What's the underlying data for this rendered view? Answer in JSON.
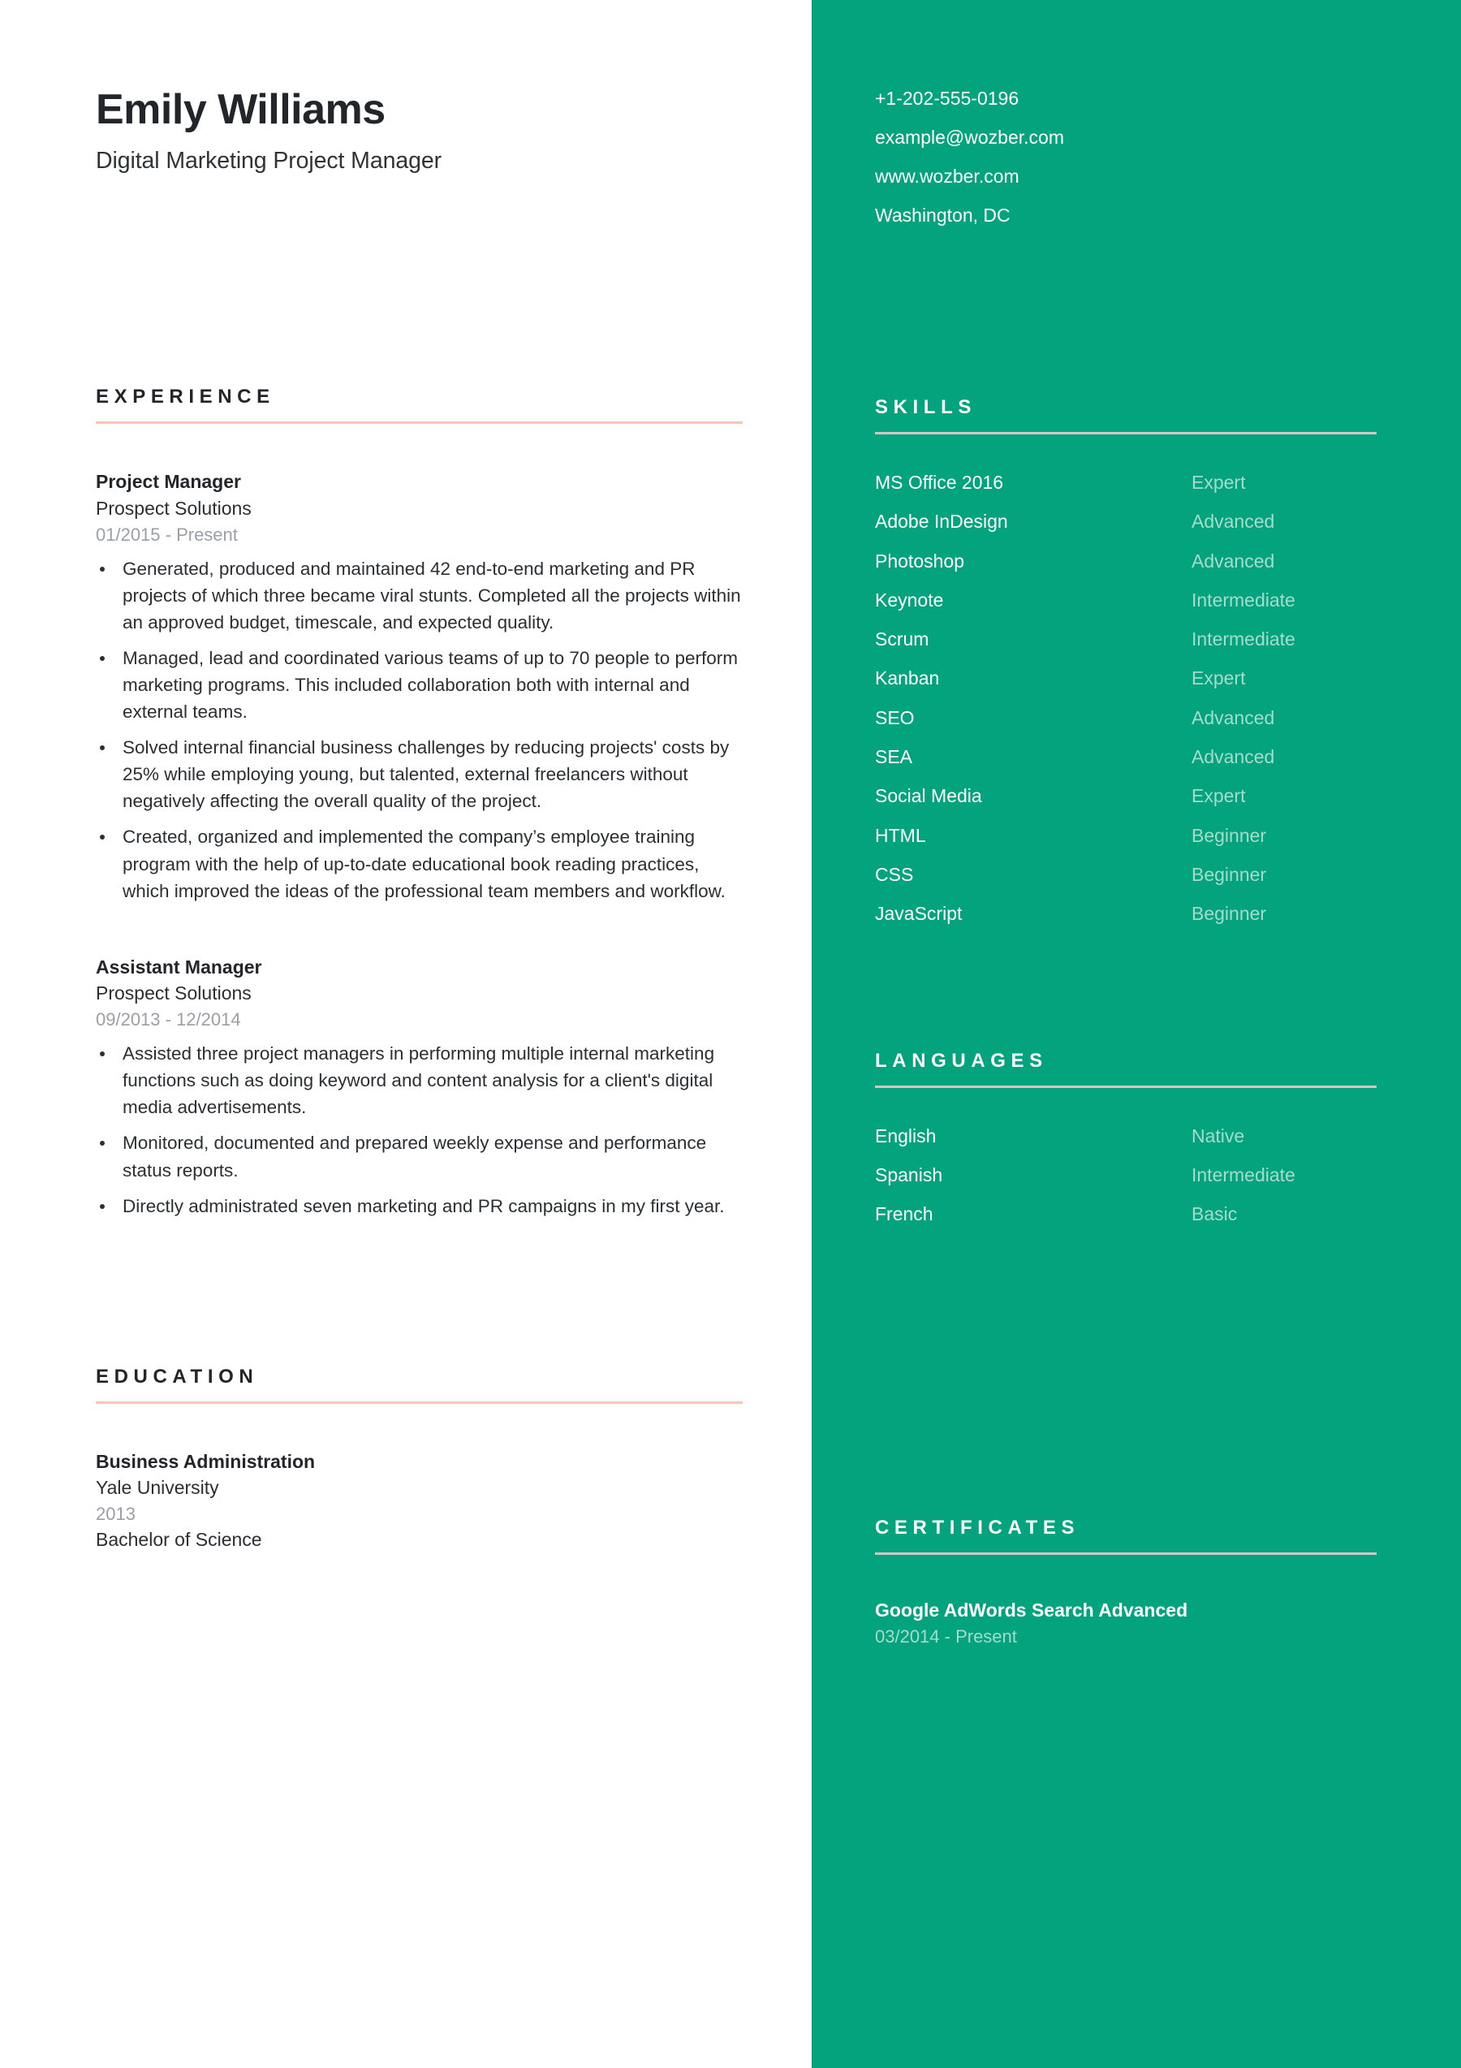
{
  "colors": {
    "accent_green": "#03a37e",
    "rule_left": "#fac6ba",
    "rule_right": "#d8c6c2",
    "muted_green_text": "#a6dccb",
    "muted_gray_text": "#9aa0a6",
    "ink": "#22262a"
  },
  "header": {
    "name": "Emily Williams",
    "headline": "Digital Marketing Project Manager"
  },
  "contact": {
    "phone": "+1-202-555-0196",
    "email": "example@wozber.com",
    "website": "www.wozber.com",
    "location": "Washington, DC"
  },
  "experience": {
    "heading": "EXPERIENCE",
    "entries": [
      {
        "title": "Project Manager",
        "organization": "Prospect Solutions",
        "date": "01/2015 - Present",
        "bullets": [
          "Generated, produced and maintained 42 end-to-end marketing and PR projects of which three became viral stunts. Completed all the projects within an approved budget, timescale, and expected quality.",
          "Managed, lead and coordinated various teams of up to 70 people to perform marketing programs. This included collaboration both with internal and external teams.",
          "Solved internal financial business challenges by reducing projects' costs by 25% while employing young, but talented, external freelancers without negatively affecting the overall quality of the project.",
          "Created, organized and implemented the company’s employee training program with the help of up-to-date educational book reading practices, which improved the ideas of the professional team members and workflow."
        ]
      },
      {
        "title": "Assistant Manager",
        "organization": "Prospect Solutions",
        "date": "09/2013 - 12/2014",
        "bullets": [
          "Assisted three project managers in performing multiple internal marketing functions such as doing keyword and content analysis for a client's digital media advertisements.",
          "Monitored, documented and prepared weekly expense and performance status reports.",
          "Directly administrated seven marketing and PR campaigns in my first year."
        ]
      }
    ]
  },
  "education": {
    "heading": "EDUCATION",
    "entries": [
      {
        "title": "Business Administration",
        "organization": "Yale University",
        "date": "2013",
        "degree": "Bachelor of Science"
      }
    ]
  },
  "skills": {
    "heading": "SKILLS",
    "items": [
      {
        "name": "MS Office 2016",
        "level": "Expert"
      },
      {
        "name": "Adobe InDesign",
        "level": "Advanced"
      },
      {
        "name": "Photoshop",
        "level": "Advanced"
      },
      {
        "name": "Keynote",
        "level": "Intermediate"
      },
      {
        "name": "Scrum",
        "level": "Intermediate"
      },
      {
        "name": "Kanban",
        "level": "Expert"
      },
      {
        "name": "SEO",
        "level": "Advanced"
      },
      {
        "name": "SEA",
        "level": "Advanced"
      },
      {
        "name": "Social Media",
        "level": "Expert"
      },
      {
        "name": "HTML",
        "level": "Beginner"
      },
      {
        "name": "CSS",
        "level": "Beginner"
      },
      {
        "name": "JavaScript",
        "level": "Beginner"
      }
    ]
  },
  "languages": {
    "heading": "LANGUAGES",
    "items": [
      {
        "name": "English",
        "level": "Native"
      },
      {
        "name": "Spanish",
        "level": "Intermediate"
      },
      {
        "name": "French",
        "level": "Basic"
      }
    ]
  },
  "certificates": {
    "heading": "CERTIFICATES",
    "items": [
      {
        "name": "Google AdWords Search Advanced",
        "date": "03/2014 - Present"
      }
    ]
  }
}
